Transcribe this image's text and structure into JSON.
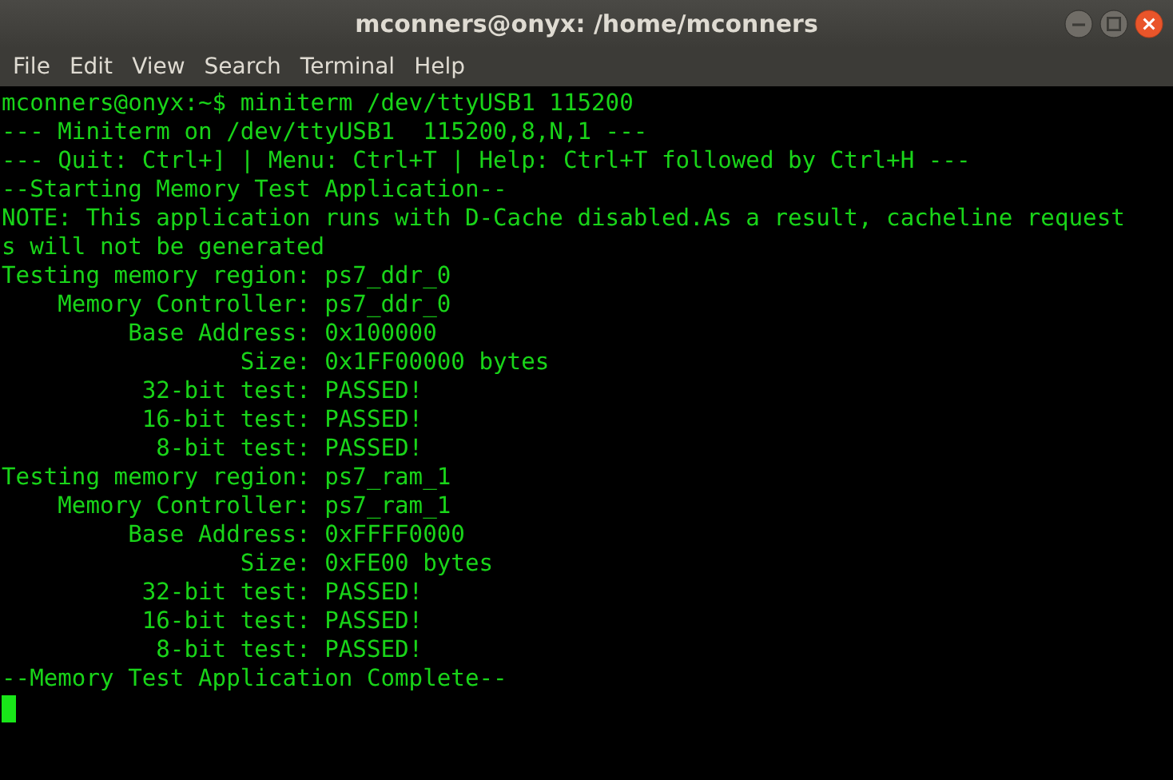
{
  "window": {
    "title": "mconners@onyx: /home/mconners"
  },
  "menu": [
    "File",
    "Edit",
    "View",
    "Search",
    "Terminal",
    "Help"
  ],
  "terminal": {
    "lines": [
      "mconners@onyx:~$ miniterm /dev/ttyUSB1 115200",
      "--- Miniterm on /dev/ttyUSB1  115200,8,N,1 ---",
      "--- Quit: Ctrl+] | Menu: Ctrl+T | Help: Ctrl+T followed by Ctrl+H ---",
      "--Starting Memory Test Application--",
      "NOTE: This application runs with D-Cache disabled.As a result, cacheline request",
      "s will not be generated",
      "Testing memory region: ps7_ddr_0",
      "    Memory Controller: ps7_ddr_0",
      "         Base Address: 0x100000",
      "                 Size: 0x1FF00000 bytes",
      "          32-bit test: PASSED!",
      "          16-bit test: PASSED!",
      "           8-bit test: PASSED!",
      "Testing memory region: ps7_ram_1",
      "    Memory Controller: ps7_ram_1",
      "         Base Address: 0xFFFF0000",
      "                 Size: 0xFE00 bytes",
      "          32-bit test: PASSED!",
      "          16-bit test: PASSED!",
      "           8-bit test: PASSED!",
      "--Memory Test Application Complete--"
    ]
  }
}
